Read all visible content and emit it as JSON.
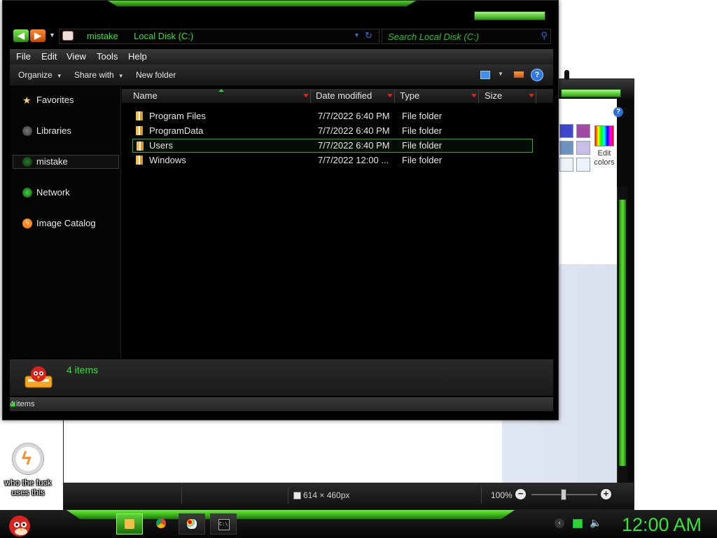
{
  "explorer": {
    "breadcrumb": [
      "mistake",
      "Local Disk (C:)"
    ],
    "search_placeholder": "Search Local Disk (C:)",
    "menu": [
      "File",
      "Edit",
      "View",
      "Tools",
      "Help"
    ],
    "commands": {
      "organize": "Organize",
      "share_with": "Share with",
      "new_folder": "New folder"
    },
    "nav": {
      "favorites": "Favorites",
      "libraries": "Libraries",
      "mistake": "mistake",
      "network": "Network",
      "image_catalog": "Image Catalog"
    },
    "columns": {
      "name": "Name",
      "date_modified": "Date modified",
      "type": "Type",
      "size": "Size"
    },
    "files": [
      {
        "name": "Program Files",
        "date": "7/7/2022 6:40 PM",
        "type": "File folder"
      },
      {
        "name": "ProgramData",
        "date": "7/7/2022 6:40 PM",
        "type": "File folder"
      },
      {
        "name": "Users",
        "date": "7/7/2022 6:40 PM",
        "type": "File folder"
      },
      {
        "name": "Windows",
        "date": "7/7/2022 12:00 ...",
        "type": "File folder"
      }
    ],
    "selected_file": "Users",
    "details_count": "4 items",
    "status_text": "4 items"
  },
  "paint": {
    "edit_colors": [
      "Edit",
      "colors"
    ],
    "dimensions": "614 × 460px",
    "zoom": "100%",
    "zoom_out": "−",
    "zoom_in": "+",
    "help": "?"
  },
  "desktop": {
    "icon_label": "who the fuck uses this"
  },
  "taskbar": {
    "clock": "12:00 AM"
  },
  "colors": {
    "accent_green": "#2ee62e",
    "trim_green": "#4fd421",
    "background": "#000000"
  },
  "icons": [
    "back-arrow-icon",
    "forward-arrow-icon",
    "refresh-icon",
    "search-icon",
    "star-icon",
    "libraries-icon",
    "network-icon",
    "folder-icon",
    "help-icon",
    "angry-bird-start-icon",
    "chrome-icon",
    "paint-icon",
    "cmd-icon",
    "volume-icon",
    "network-tray-icon"
  ]
}
